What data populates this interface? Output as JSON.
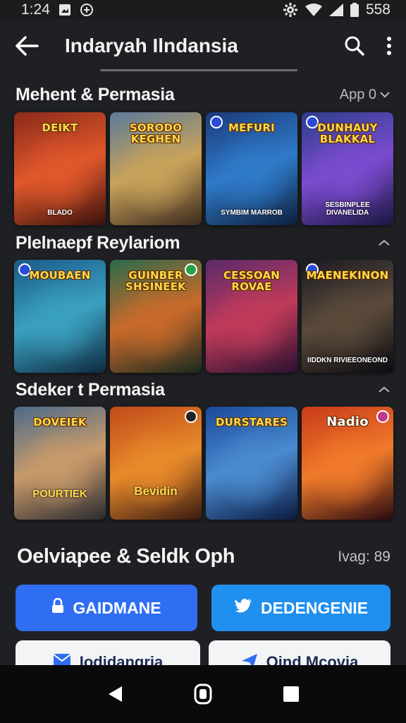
{
  "status_bar": {
    "time": "1:24",
    "battery": "558"
  },
  "app_bar": {
    "title": "Indaryah Ilndansia",
    "icons": [
      "back-arrow-icon",
      "search-icon",
      "more-vert-icon"
    ]
  },
  "sections": [
    {
      "title": "Mehent & Permasia",
      "meta": "App 0",
      "cards": [
        {
          "title": "DEIKT",
          "subtitle": "BLADO",
          "colors": [
            "#8a2a1a",
            "#e0572b",
            "#3a120c"
          ]
        },
        {
          "title": "SORODO KEGHEN",
          "subtitle": "",
          "colors": [
            "#5c7a9a",
            "#c8a25a",
            "#3b2a1e"
          ]
        },
        {
          "title": "MEFURI",
          "subtitle": "SYMBIM MARROB",
          "colors": [
            "#1a3a7a",
            "#2f7ac9",
            "#0d1f3c"
          ]
        },
        {
          "title": "DUNHAUY BLAKKAL",
          "subtitle": "SESBINPLEE DIVANELIDA",
          "colors": [
            "#2c3f8a",
            "#7b4bd0",
            "#1a1740"
          ]
        }
      ]
    },
    {
      "title": "Plelnaepf Reylariom",
      "meta": "",
      "cards": [
        {
          "title": "MOUBAEN",
          "subtitle": "",
          "colors": [
            "#1b5a8a",
            "#3aa0c0",
            "#0e2a40"
          ]
        },
        {
          "title": "GUINBER SHSINEEK",
          "subtitle": "",
          "colors": [
            "#2a6a4a",
            "#c86a2a",
            "#1a2a20"
          ]
        },
        {
          "title": "CESSOAN ROVAE",
          "subtitle": "",
          "colors": [
            "#5a2a6a",
            "#c03a5a",
            "#2a1030"
          ]
        },
        {
          "title": "MAENEKINON",
          "subtitle": "IIDDKN RIVIEEONEOND",
          "colors": [
            "#1a1a22",
            "#5a4a3a",
            "#0a0a10"
          ]
        }
      ]
    },
    {
      "title": "Sdeker t Permasia",
      "meta": "",
      "cards": [
        {
          "title": "DOVEIEK",
          "subtitle": "POURTIEK",
          "colors": [
            "#4a6a8a",
            "#c89a6a",
            "#2a2a30"
          ]
        },
        {
          "title": "",
          "subtitle": "Bevidin",
          "colors": [
            "#c04a1a",
            "#e88a2a",
            "#3a1a10"
          ]
        },
        {
          "title": "DURSTARES",
          "subtitle": "",
          "colors": [
            "#1a4a9a",
            "#4a8ad0",
            "#0a1a40"
          ]
        },
        {
          "title": "Nadio",
          "subtitle": "",
          "colors": [
            "#c83a1a",
            "#f07a2a",
            "#2a0a10"
          ]
        }
      ]
    }
  ],
  "bottom": {
    "title": "Oelviapee & Seldk Oph",
    "meta": "Ivag: 89",
    "primary_button": "GAIDMANE",
    "secondary_button": "DEDENGENIE",
    "light_button_1": "Iodidangria",
    "light_button_2": "Oind Mcovia"
  },
  "colors": {
    "primary": "#2f6ef2",
    "secondary": "#1f8ff0",
    "background": "#1f2023"
  }
}
